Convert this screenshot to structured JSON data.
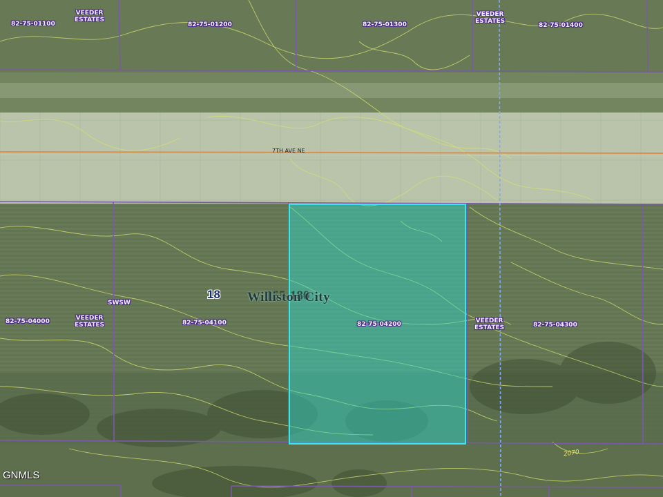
{
  "map": {
    "road_name": "7TH AVE NE",
    "section_number": "18",
    "town_name": "Williston City",
    "town_overlay": "155-180",
    "corner_label": "SWSW",
    "contour_label": "2070",
    "watermark": "GNMLS",
    "subdivision_labels": [
      "VEEDER\nESTATES",
      "VEEDER\nESTATES",
      "VEEDER\nESTATES",
      "VEEDER\nESTATES"
    ],
    "parcels": [
      "82-75-01100",
      "82-75-01200",
      "82-75-01300",
      "82-75-01400",
      "82-75-04000",
      "82-75-04100",
      "82-75-04200",
      "82-75-04300"
    ],
    "highlighted_parcel": "82-75-04200",
    "colors": {
      "parcel_line": "#7a5aa8",
      "highlight_fill": "#2fd6c8",
      "highlight_stroke": "#39e6f0",
      "contour": "#d6e070",
      "road_line": "#d98f4e",
      "section_line": "#7fa8ff"
    }
  }
}
